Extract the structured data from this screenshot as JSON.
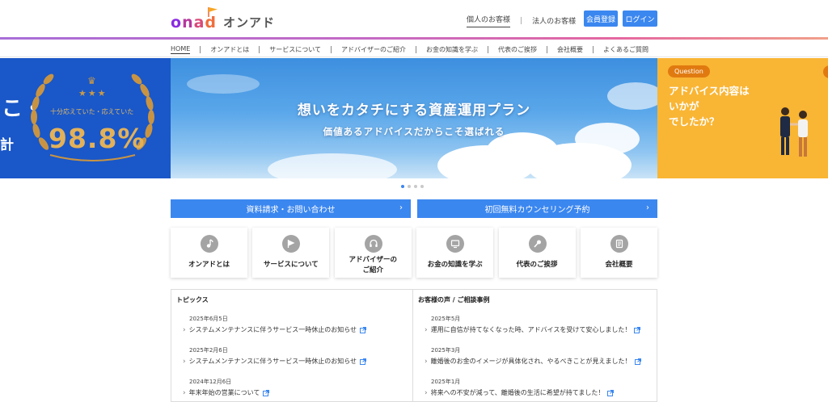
{
  "brand": {
    "logo_letters": [
      "o",
      "n",
      "a",
      "d"
    ],
    "name": "オンアド",
    "colors": {
      "accent_blue": "#3b87f0",
      "hero_left_bg": "#1a57c8",
      "hero_right_bg": "#f9b534"
    }
  },
  "header": {
    "personal_label": "個人のお客様",
    "corporate_label": "法人のお客様",
    "register_label": "会員登録",
    "login_label": "ログイン"
  },
  "nav": {
    "items": [
      "HOME",
      "オンアドとは",
      "サービスについて",
      "アドバイザーのご紹介",
      "お金の知識を学ぶ",
      "代表のご挨拶",
      "会社概要",
      "よくあるご質問"
    ],
    "active_index": 0
  },
  "hero": {
    "left": {
      "partial_text_1": "こ・",
      "partial_text_2": "計",
      "caption": "十分応えていた・応えていた",
      "percent": "98.8%"
    },
    "center": {
      "title": "想いをカタチにする資産運用プラン",
      "subtitle": "価値あるアドバイスだからこそ選ばれる"
    },
    "right": {
      "badge": "Question",
      "line1": "アドバイス内容は",
      "line2": "いかが",
      "line3": "でしたか？"
    },
    "slide_count": 4,
    "active_slide": 0
  },
  "cta": {
    "inquiry_label": "資料請求・お問い合わせ",
    "counseling_label": "初回無料カウンセリング予約"
  },
  "tiles": [
    {
      "icon": "music-note-icon",
      "label_lines": [
        "オンアドとは"
      ]
    },
    {
      "icon": "flag-icon",
      "label_lines": [
        "サービスについて"
      ]
    },
    {
      "icon": "headset-icon",
      "label_lines": [
        "アドバイザーの",
        "ご紹介"
      ]
    },
    {
      "icon": "monitor-icon",
      "label_lines": [
        "お金の知識を学ぶ"
      ]
    },
    {
      "icon": "microphone-icon",
      "label_lines": [
        "代表のご挨拶"
      ]
    },
    {
      "icon": "document-icon",
      "label_lines": [
        "会社概要"
      ]
    }
  ],
  "topics": {
    "heading": "トピックス",
    "items": [
      {
        "date": "2025年6月5日",
        "title": "システムメンテナンスに伴うサービス一時休止のお知らせ"
      },
      {
        "date": "2025年2月6日",
        "title": "システムメンテナンスに伴うサービス一時休止のお知らせ"
      },
      {
        "date": "2024年12月6日",
        "title": "年末年始の営業について"
      }
    ]
  },
  "voices": {
    "heading": "お客様の声 / ご相談事例",
    "items": [
      {
        "date": "2025年5月",
        "title": "運用に自信が持てなくなった時、アドバイスを受けて安心しました！"
      },
      {
        "date": "2025年3月",
        "title": "離婚後のお金のイメージが具体化され、やるべきことが見えました！"
      },
      {
        "date": "2025年1月",
        "title": "将来への不安が減って、離婚後の生活に希望が持てました！"
      }
    ]
  }
}
